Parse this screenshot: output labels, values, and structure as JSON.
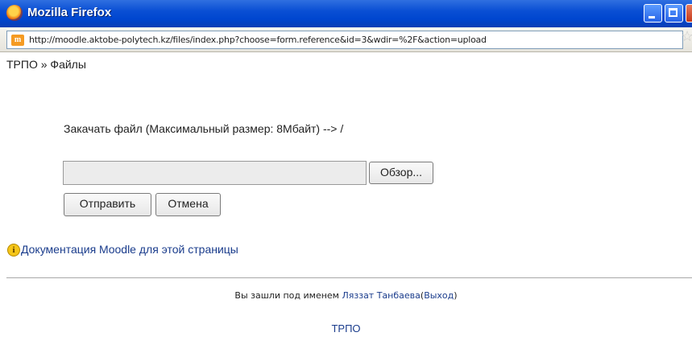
{
  "window": {
    "title": "Mozilla Firefox"
  },
  "address_bar": {
    "url": "http://moodle.aktobe-polytech.kz/files/index.php?choose=form.reference&id=3&wdir=%2F&action=upload",
    "site_icon_text": "m"
  },
  "breadcrumb": {
    "course": "ТРПО",
    "separator": "»",
    "current": "Файлы"
  },
  "upload": {
    "label": "Закачать файл (Максимальный размер: 8Мбайт) --> /",
    "file_value": "",
    "browse_label": "Обзор...",
    "submit_label": "Отправить",
    "cancel_label": "Отмена"
  },
  "help": {
    "icon": "info-icon",
    "link_text": "Документация Moodle для этой страницы"
  },
  "footer": {
    "logged_in_prefix": "Вы зашли под именем",
    "user_name": "Ляззат Танбаева",
    "logout_open": "(",
    "logout_label": "Выход",
    "logout_close": ")",
    "course_link": "ТРПО"
  },
  "colors": {
    "titlebar": "#0a4fd4",
    "link": "#1a3c8c"
  }
}
